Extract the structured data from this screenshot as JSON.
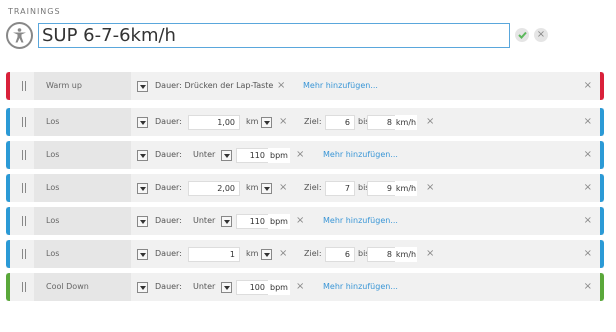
{
  "section_label": "TRAININGS",
  "title": "SUP 6-7-6km/h",
  "icons": {
    "title": "person-icon",
    "ok": "check-icon",
    "cancel": "close-icon"
  },
  "colors": {
    "red": "#d9213a",
    "blue": "#2b9ad6",
    "green": "#5aa83a",
    "accent": "#3a96d6",
    "ok": "#5cb85c"
  },
  "labels": {
    "dauer": "Dauer:",
    "lap": "Dauer: Drücken der Lap-Taste",
    "ziel": "Ziel:",
    "bis": "bis",
    "unter": "Unter",
    "more": "Mehr hinzufügen...",
    "x": "×"
  },
  "steps": [
    {
      "name": "Warm up",
      "type": "lap",
      "color": "red"
    },
    {
      "name": "Los",
      "type": "distance",
      "color": "blue",
      "value": "1,00",
      "unit": "km",
      "ziel_from": "6",
      "ziel_to": "8",
      "ziel_unit": "km/h"
    },
    {
      "name": "Los",
      "type": "hr",
      "color": "blue",
      "value": "110",
      "unit": "bpm"
    },
    {
      "name": "Los",
      "type": "distance",
      "color": "blue",
      "value": "2,00",
      "unit": "km",
      "ziel_from": "7",
      "ziel_to": "9",
      "ziel_unit": "km/h"
    },
    {
      "name": "Los",
      "type": "hr",
      "color": "blue",
      "value": "110",
      "unit": "bpm"
    },
    {
      "name": "Los",
      "type": "distance",
      "color": "blue",
      "value": "1",
      "unit": "km",
      "ziel_from": "6",
      "ziel_to": "8",
      "ziel_unit": "km/h"
    },
    {
      "name": "Cool Down",
      "type": "hr",
      "color": "green",
      "value": "100",
      "unit": "bpm"
    }
  ]
}
